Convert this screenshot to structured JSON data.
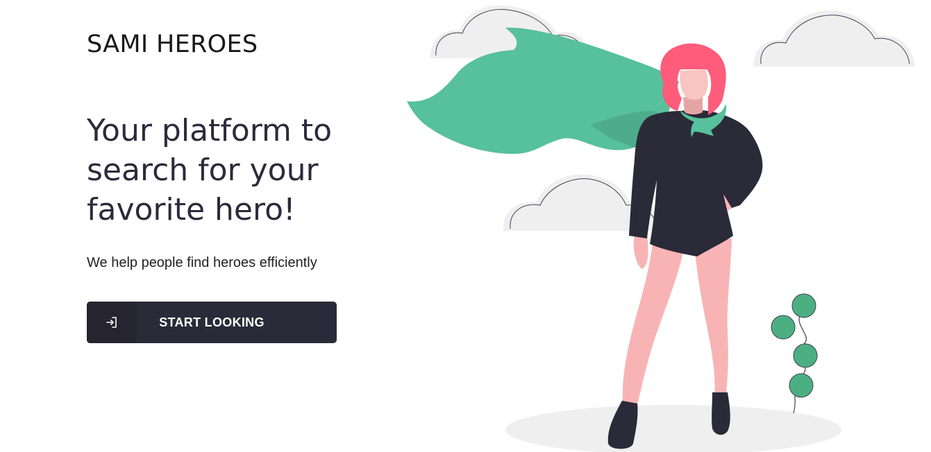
{
  "brand": {
    "name": "SAMI HEROES"
  },
  "hero": {
    "headline": "Your platform to search for your favorite hero!",
    "subtitle": "We help people find heroes efficiently"
  },
  "cta": {
    "label": "START LOOKING",
    "icon": "sign-in-icon"
  },
  "colors": {
    "dark": "#2b2a39",
    "cape": "#57c09c",
    "skin": "#f8b4b4",
    "hair": "#ff5c7c",
    "cloud": "#efefef",
    "plant": "#4caf82"
  },
  "illustration": {
    "subject": "superhero-woman-illustration"
  }
}
